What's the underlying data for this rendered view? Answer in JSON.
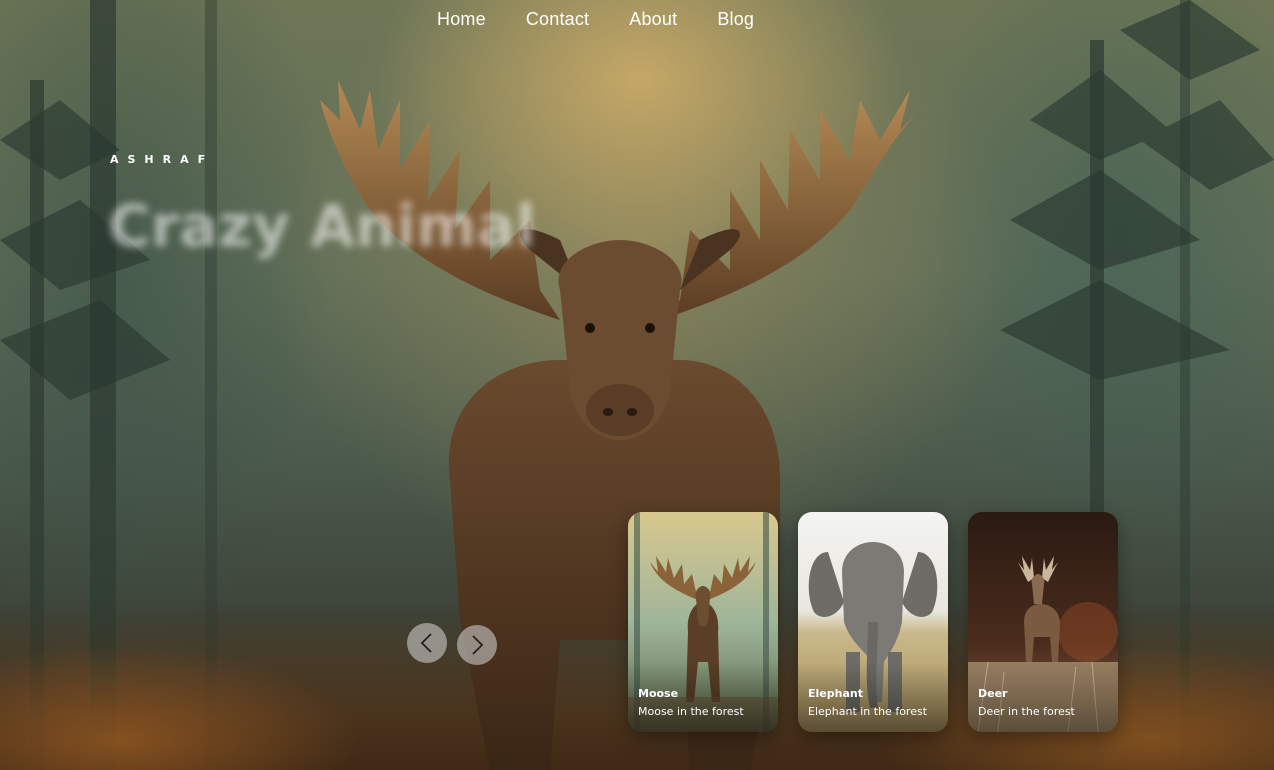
{
  "nav": {
    "items": [
      {
        "label": "Home"
      },
      {
        "label": "Contact"
      },
      {
        "label": "About"
      },
      {
        "label": "Blog"
      }
    ]
  },
  "hero": {
    "brand": "ASHRAF",
    "title": "Crazy Animal"
  },
  "slider": {
    "prev_icon": "chevron-left-icon",
    "next_icon": "chevron-right-icon",
    "cards": [
      {
        "title": "Moose",
        "description": "Moose in the forest"
      },
      {
        "title": "Elephant",
        "description": "Elephant in the forest"
      },
      {
        "title": "Deer",
        "description": "Deer in the forest"
      }
    ]
  },
  "colors": {
    "text": "#ffffff",
    "arrow_bg": "#d7d7d7"
  }
}
